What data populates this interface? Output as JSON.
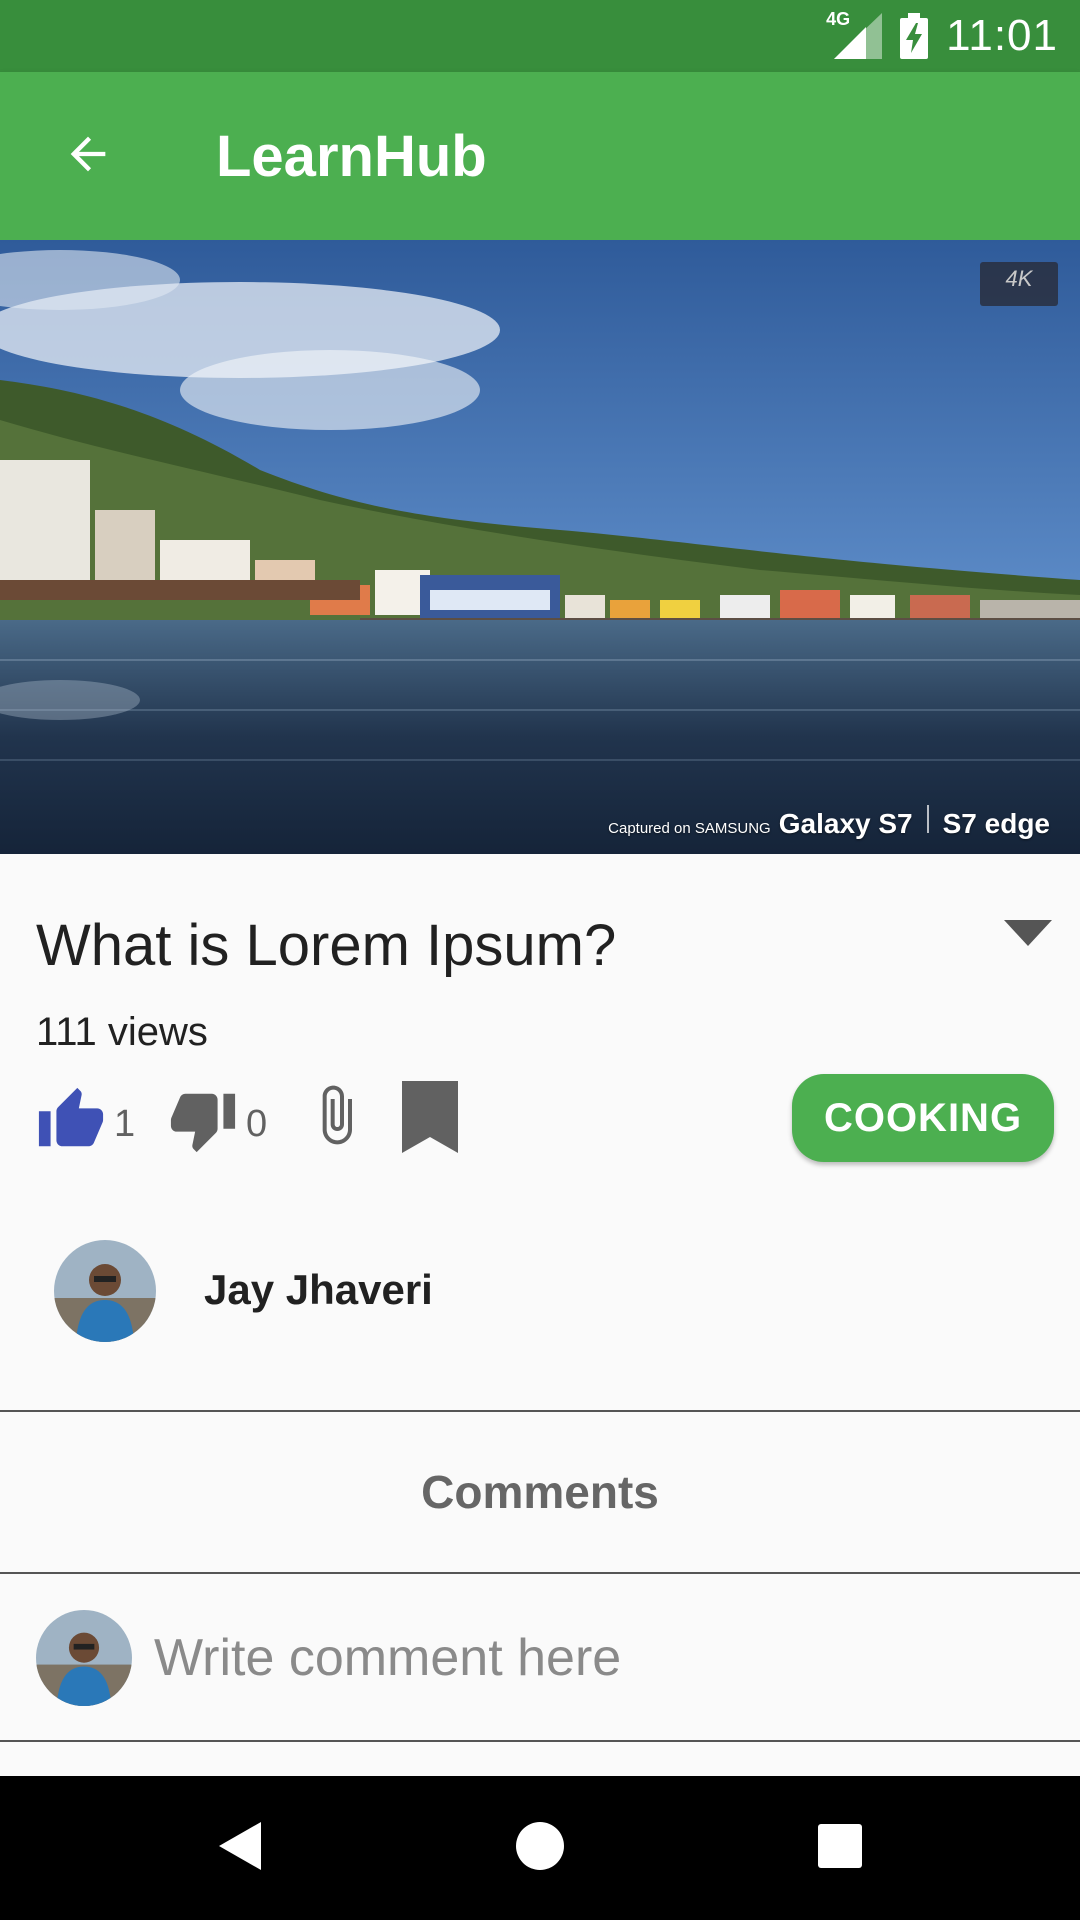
{
  "status_bar": {
    "network": "4G",
    "time": "11:01"
  },
  "app_bar": {
    "back_icon": "arrow-back-icon",
    "title": "LearnHub"
  },
  "video": {
    "badge": "4K",
    "watermark_small": "Captured on SAMSUNG",
    "watermark_model": "Galaxy S7",
    "watermark_edge": "S7 edge"
  },
  "post": {
    "title": "What is Lorem Ipsum?",
    "views": "111 views",
    "likes": "1",
    "dislikes": "0",
    "category": "COOKING",
    "like_color": "#3f51b5",
    "icon_color": "#616161"
  },
  "author": {
    "name": "Jay Jhaveri"
  },
  "comments": {
    "header": "Comments",
    "placeholder": "Write comment here"
  },
  "colors": {
    "primary": "#4caf50",
    "primary_dark": "#388e3c"
  }
}
